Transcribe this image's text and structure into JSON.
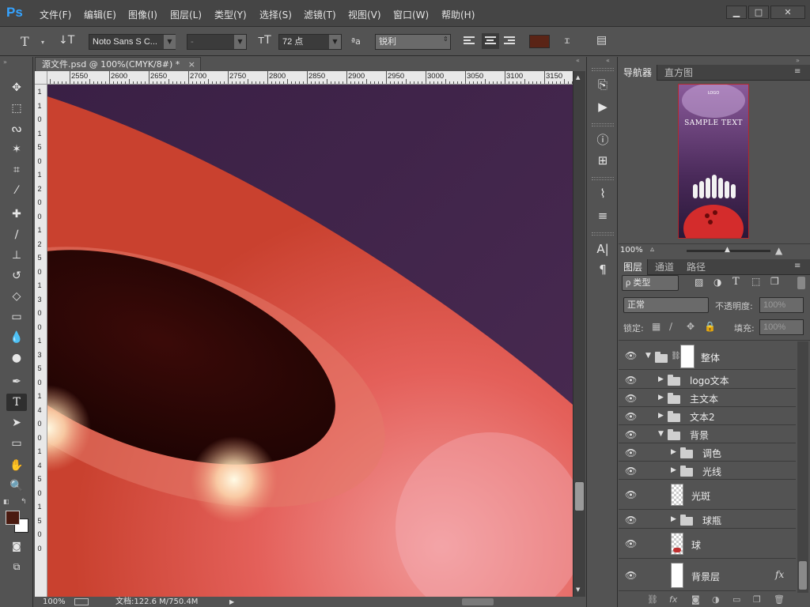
{
  "app": {
    "logo": "Ps"
  },
  "menu": [
    "文件(F)",
    "编辑(E)",
    "图像(I)",
    "图层(L)",
    "类型(Y)",
    "选择(S)",
    "滤镜(T)",
    "视图(V)",
    "窗口(W)",
    "帮助(H)"
  ],
  "window_controls": {
    "minimize": "▁",
    "maximize": "□",
    "close": "✕"
  },
  "options": {
    "tool_glyph": "T",
    "font_family": "Noto Sans S C...",
    "font_style": "-",
    "font_size": "72 点",
    "aa_label": "ªa",
    "antialias": "锐利",
    "text_color": "#5a2416"
  },
  "document": {
    "tab_title": "源文件.psd @ 100%(CMYK/8#) *",
    "ruler_h": [
      "2550",
      "2600",
      "2650",
      "2700",
      "2750",
      "2800",
      "2850",
      "2900",
      "2950",
      "3000",
      "3050",
      "3100",
      "3150"
    ],
    "ruler_v": [
      "1",
      "1",
      "0",
      "1",
      "5",
      "0",
      "1",
      "2",
      "0",
      "0",
      "1",
      "2",
      "5",
      "0",
      "1",
      "3",
      "0",
      "0",
      "1",
      "3",
      "5",
      "0",
      "1",
      "4",
      "0",
      "0",
      "1",
      "4",
      "5",
      "0",
      "1",
      "5",
      "0",
      "0"
    ]
  },
  "status": {
    "zoom": "100%",
    "doc_size": "文档:122.6 M/750.4M"
  },
  "navigator": {
    "tabs": [
      "导航器",
      "直方图"
    ],
    "zoom": "100%",
    "thumb_title": "SAMPLE TEXT",
    "thumb_logo": "LOGO"
  },
  "layers": {
    "tabs": [
      "图层",
      "通道",
      "路径"
    ],
    "filter_kind": "ρ 类型",
    "blend_mode": "正常",
    "opacity_label": "不透明度:",
    "opacity_value": "100%",
    "lock_label": "锁定:",
    "fill_label": "填充:",
    "fill_value": "100%",
    "items": [
      {
        "name": "整体",
        "type": "group-mask"
      },
      {
        "name": "logo文本",
        "type": "folder"
      },
      {
        "name": "主文本",
        "type": "folder"
      },
      {
        "name": "文本2",
        "type": "folder"
      },
      {
        "name": "背景",
        "type": "folder-open"
      },
      {
        "name": "调色",
        "type": "folder"
      },
      {
        "name": "光线",
        "type": "folder"
      },
      {
        "name": "光斑",
        "type": "layer"
      },
      {
        "name": "球瓶",
        "type": "folder"
      },
      {
        "name": "球",
        "type": "layer"
      },
      {
        "name": "背景层",
        "type": "layer-fx"
      }
    ],
    "fx": "fx"
  },
  "colors": {
    "foreground": "#4a1a10",
    "background": "#ffffff",
    "accent_blue": "#35a3ff"
  }
}
